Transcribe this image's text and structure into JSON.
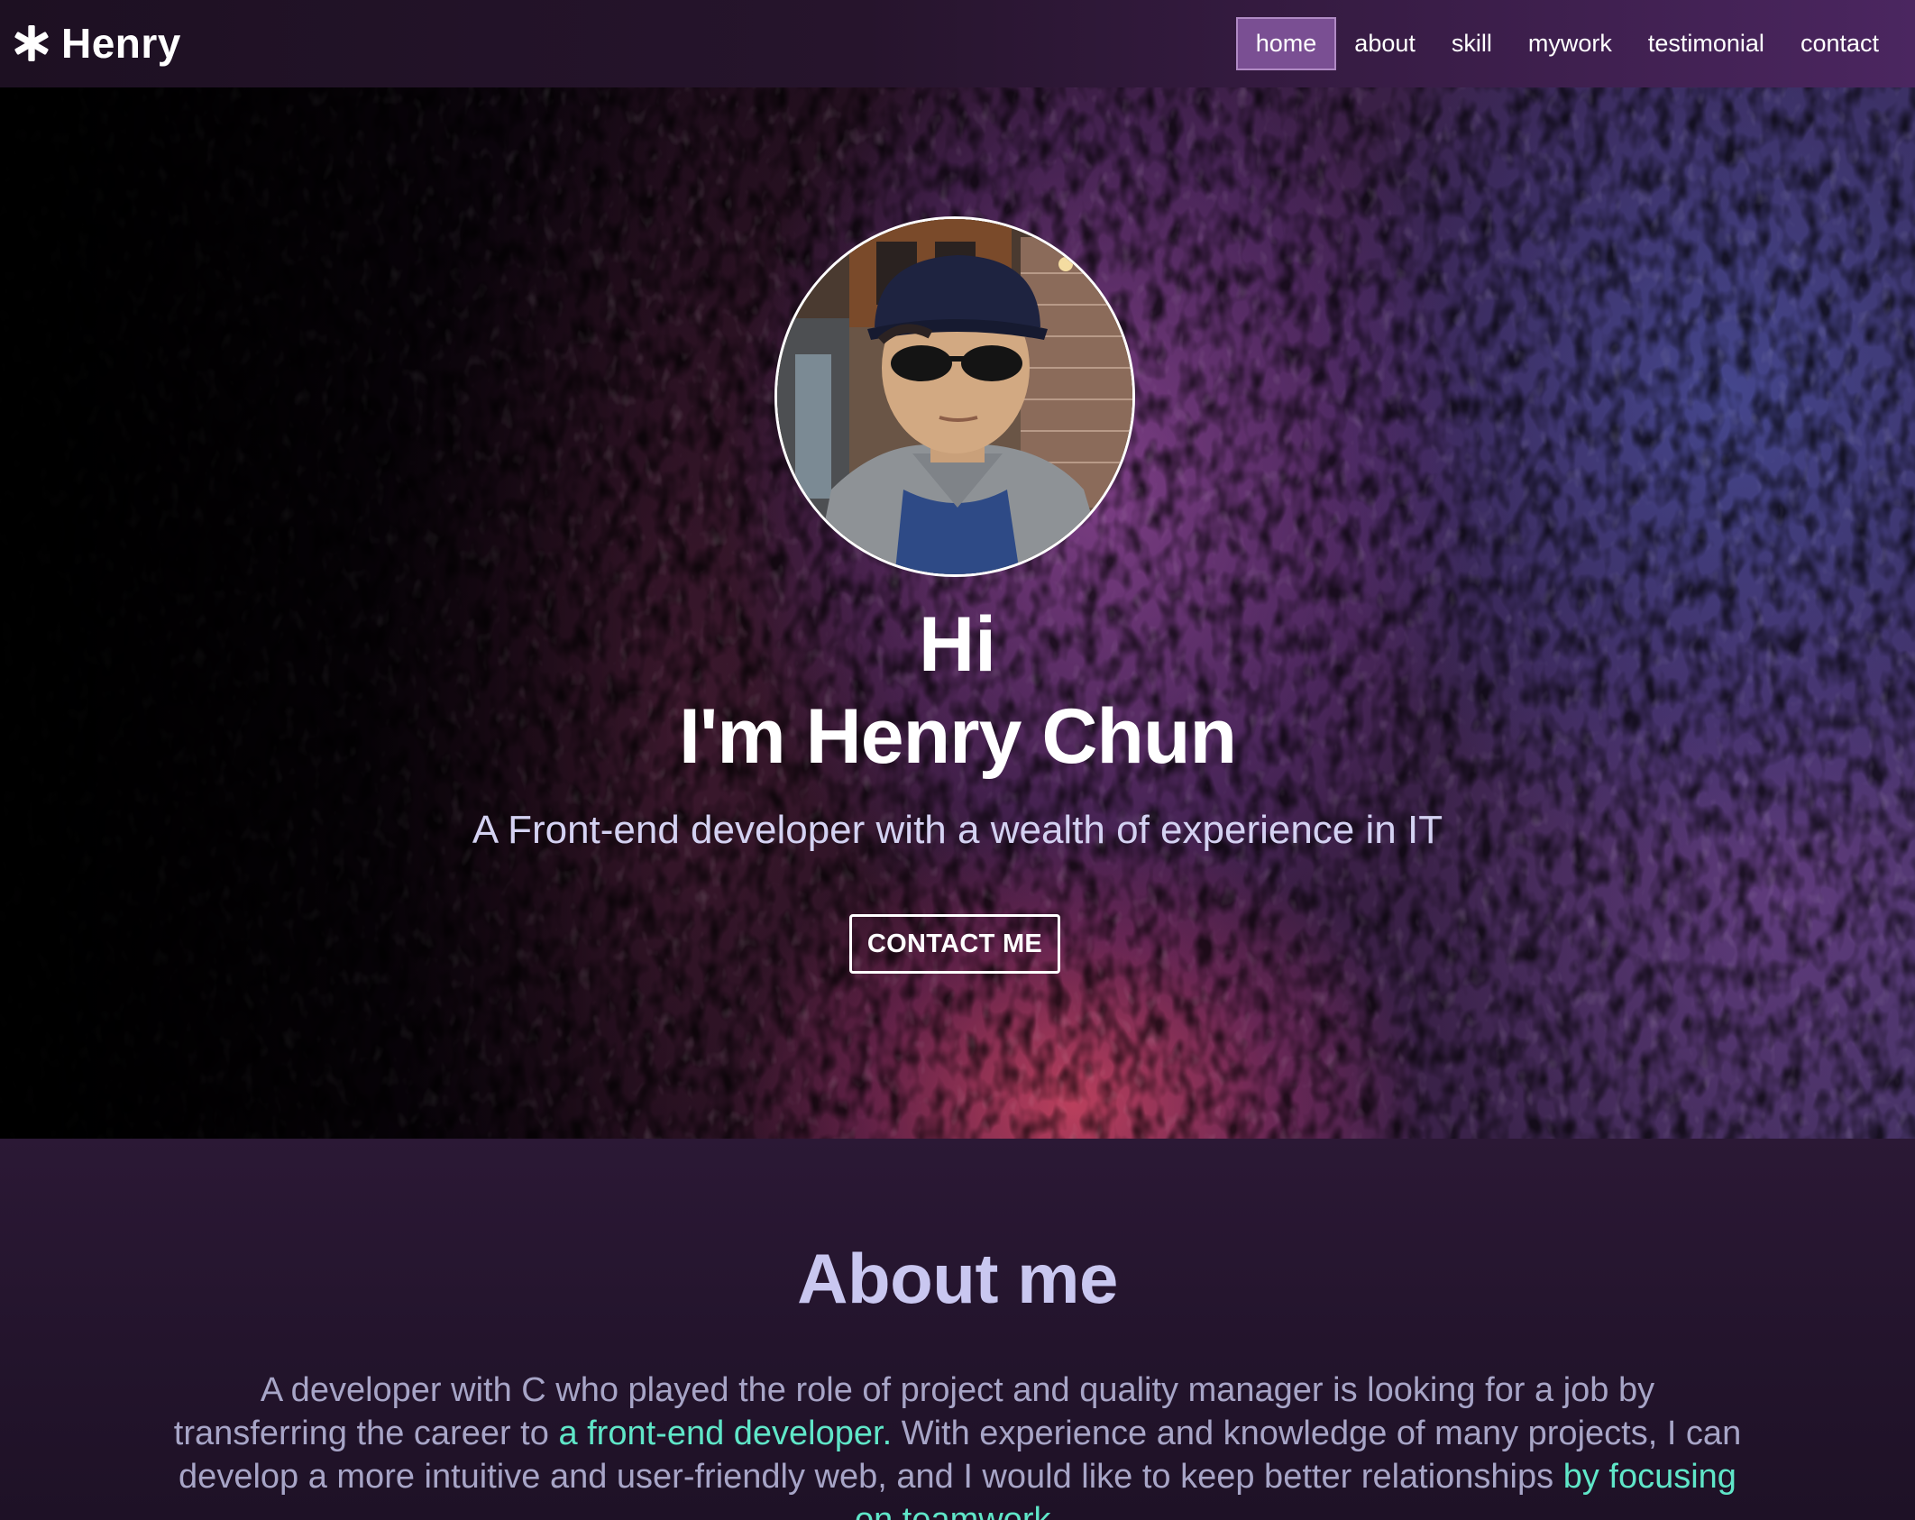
{
  "navbar": {
    "brand": "Henry",
    "brand_icon": "asterisk-icon",
    "links": [
      {
        "label": "home",
        "active": true
      },
      {
        "label": "about",
        "active": false
      },
      {
        "label": "skill",
        "active": false
      },
      {
        "label": "mywork",
        "active": false
      },
      {
        "label": "testimonial",
        "active": false
      },
      {
        "label": "contact",
        "active": false
      }
    ]
  },
  "hero": {
    "greeting": "Hi",
    "name": "I'm Henry Chun",
    "subtitle": "A Front-end developer with a wealth of experience in IT",
    "cta_label": "CONTACT ME"
  },
  "about": {
    "title": "About me",
    "text_parts": [
      "A developer with C who played the role of project and quality manager is looking for a job by transferring the career to ",
      "a front-end developer.",
      " With experience and knowledge of many projects, I can develop a more intuitive and user-friendly web, and I would like to keep better relationships ",
      "by focusing on teamwork",
      "."
    ]
  },
  "colors": {
    "accent": "#7a4f93",
    "highlight": "#5fe6c8",
    "heading": "#c9c7f0",
    "body_text": "#a7a5c7"
  }
}
